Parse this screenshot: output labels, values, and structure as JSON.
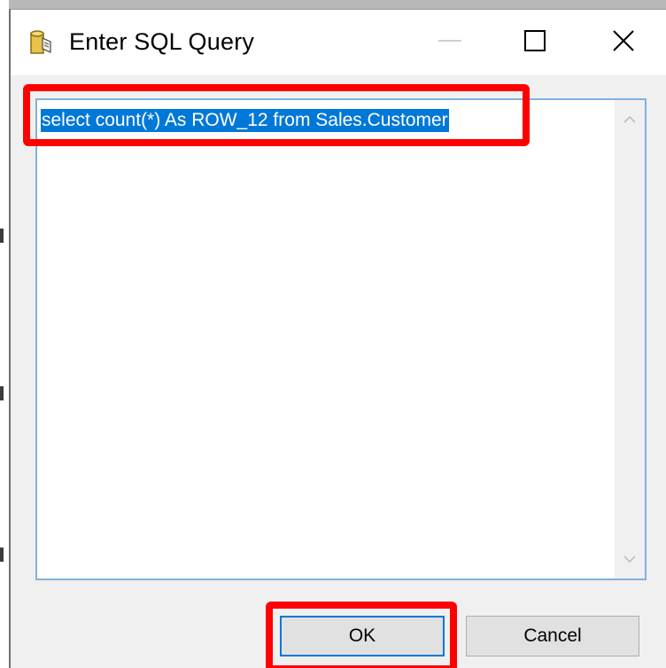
{
  "window": {
    "title": "Enter SQL Query",
    "title_icon": "database-icon",
    "controls": {
      "minimize_icon": "minimize-icon",
      "maximize_icon": "maximize-icon",
      "close_icon": "close-icon"
    }
  },
  "editor": {
    "query_text": "select count(*) As ROW_12 from Sales.Customer",
    "selection_color": "#0078d7",
    "scroll_up_icon": "chevron-up-icon",
    "scroll_down_icon": "chevron-down-icon"
  },
  "buttons": {
    "ok_label": "OK",
    "cancel_label": "Cancel"
  },
  "colors": {
    "highlight": "#ff0000",
    "focus_border": "#0078d7"
  }
}
